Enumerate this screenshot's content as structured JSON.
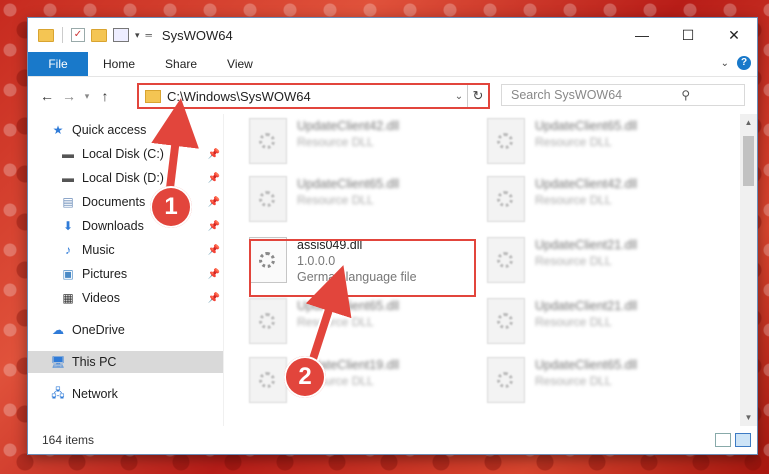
{
  "window": {
    "title": "SysWOW64"
  },
  "ribbon": {
    "file": "File",
    "tabs": [
      "Home",
      "Share",
      "View"
    ],
    "help": "?"
  },
  "address": {
    "path": "C:\\Windows\\SysWOW64",
    "search_placeholder": "Search SysWOW64"
  },
  "nav": {
    "items": [
      {
        "label": "Quick access",
        "icon": "star-icon"
      },
      {
        "label": "Local Disk (C:)",
        "icon": "drive-icon"
      },
      {
        "label": "Local Disk (D:)",
        "icon": "drive-icon"
      },
      {
        "label": "Documents",
        "icon": "documents-icon"
      },
      {
        "label": "Downloads",
        "icon": "download-icon"
      },
      {
        "label": "Music",
        "icon": "music-icon"
      },
      {
        "label": "Pictures",
        "icon": "pictures-icon"
      },
      {
        "label": "Videos",
        "icon": "videos-icon"
      },
      {
        "label": "OneDrive",
        "icon": "cloud-icon"
      },
      {
        "label": "This PC",
        "icon": "computer-icon"
      },
      {
        "label": "Network",
        "icon": "network-icon"
      }
    ]
  },
  "files": [
    {
      "name": "UpdateClient42.dll",
      "sub": "Resource DLL"
    },
    {
      "name": "UpdateClient65.dll",
      "sub": "Resource DLL"
    },
    {
      "name": "UpdateClient65.dll",
      "sub": "Resource DLL"
    },
    {
      "name": "UpdateClient42.dll",
      "sub": "Resource DLL"
    },
    {
      "name": "assis049.dll",
      "version": "1.0.0.0",
      "sub": "German language file"
    },
    {
      "name": "UpdateClient21.dll",
      "sub": "Resource DLL"
    },
    {
      "name": "UpdateClient65.dll",
      "sub": "Resource DLL"
    },
    {
      "name": "UpdateClient21.dll",
      "sub": "Resource DLL"
    },
    {
      "name": "UpdateClient19.dll",
      "sub": "Resource DLL"
    },
    {
      "name": "UpdateClient65.dll",
      "sub": "Resource DLL"
    }
  ],
  "status": {
    "count": "164 items"
  },
  "annotations": {
    "step1": "1",
    "step2": "2"
  },
  "colors": {
    "accent": "#1979ca",
    "highlight": "#e2453c"
  }
}
